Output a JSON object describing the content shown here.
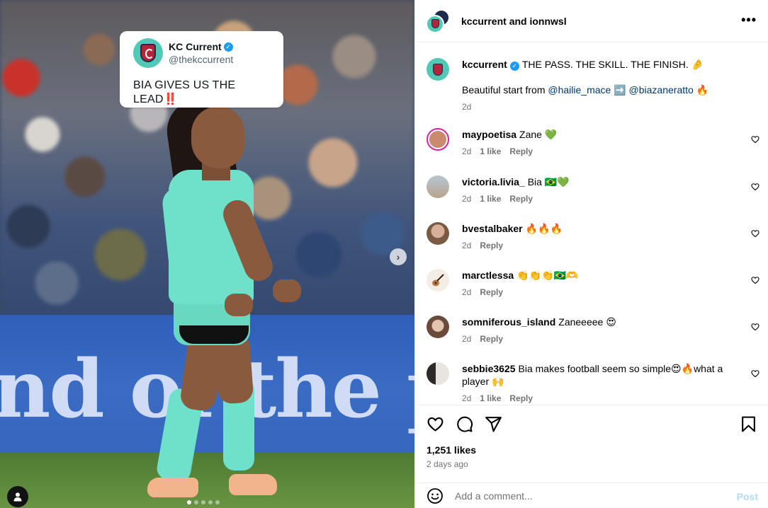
{
  "media": {
    "tweet": {
      "name": "KC Current",
      "handle": "@thekccurrent",
      "text": "BIA GIVES US THE LEAD",
      "emphasis": "‼️"
    },
    "board_text": "nd of the pi",
    "next_glyph": "›",
    "carousel": {
      "total": 5,
      "active_index": 0
    }
  },
  "header": {
    "title": "kccurrent and ionnwsl",
    "more_glyph": "•••"
  },
  "caption": {
    "user": "kccurrent",
    "text": "THE PASS. THE SKILL. THE FINISH. 🤌",
    "line2_prefix": "Beautiful start from",
    "mention1": "@hailie_mace",
    "arrow": "➡️",
    "mention2": "@biazaneratto",
    "line2_suffix": "🔥",
    "time": "2d"
  },
  "comments": [
    {
      "user": "maypoetisa",
      "text": "Zane 💚",
      "time": "2d",
      "likes": "1 like",
      "reply": "Reply",
      "avatar_color": "#c98a6e"
    },
    {
      "user": "victoria.livia_",
      "text": "Bia 🇧🇷💚",
      "time": "2d",
      "likes": "1 like",
      "reply": "Reply",
      "avatar_color": "#b8a48c"
    },
    {
      "user": "bvestalbaker",
      "text": "🔥🔥🔥",
      "time": "2d",
      "likes": "",
      "reply": "Reply",
      "avatar_color": "#b88a6a"
    },
    {
      "user": "marctlessa",
      "text": "👏👏👏🇧🇷🫶",
      "time": "2d",
      "likes": "",
      "reply": "Reply",
      "avatar_color": "#e8dccb"
    },
    {
      "user": "somniferous_island",
      "text": "Zaneeeee 😍",
      "time": "2d",
      "likes": "",
      "reply": "Reply",
      "avatar_color": "#6a4a3a"
    },
    {
      "user": "sebbie3625",
      "text": "Bia makes football seem so simple😍🔥what a player 🙌",
      "time": "2d",
      "likes": "1 like",
      "reply": "Reply",
      "avatar_color": "#2d2a2a"
    }
  ],
  "actions": {
    "likes": "1,251 likes",
    "posted": "2 days ago"
  },
  "composer": {
    "placeholder": "Add a comment...",
    "post_label": "Post"
  },
  "colors": {
    "mention": "#00376b",
    "meta_gray": "#737373",
    "post_disabled": "#b3dbff",
    "kc_teal": "#52c9b6"
  }
}
